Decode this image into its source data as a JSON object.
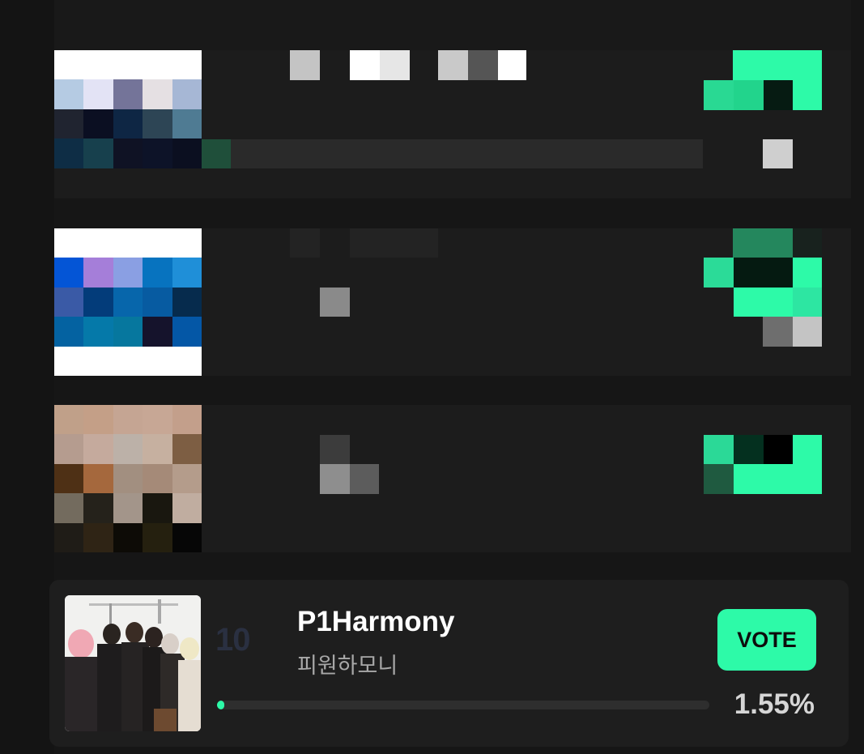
{
  "list": {
    "entries": [
      {
        "rank": "10",
        "name": "P1Harmony",
        "subname": "피원하모니",
        "vote_label": "VOTE",
        "percent": "1.55%",
        "percent_value": 1.55
      }
    ]
  },
  "colors": {
    "accent": "#2dfaa8",
    "background": "#161616",
    "card": "#1e1e1e"
  }
}
